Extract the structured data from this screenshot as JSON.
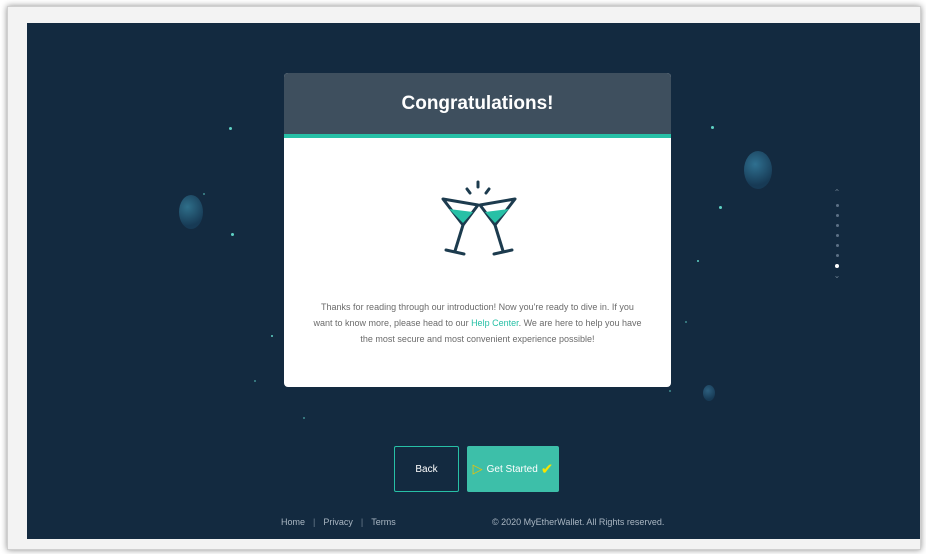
{
  "modal": {
    "title": "Congratulations!",
    "text_before_link": "Thanks for reading through our introduction! Now you're ready to dive in. If you want to know more, please head to our ",
    "link_text": "Help Center",
    "text_after_link": ". We are here to help you have the most secure and most convenient experience possible!",
    "icon": "cheers-cocktail-icon"
  },
  "pager": {
    "up_icon": "chevron-up-icon",
    "down_icon": "chevron-down-icon",
    "total": 7,
    "active_index": 6
  },
  "buttons": {
    "back_label": "Back",
    "get_started_label": "Get Started"
  },
  "footer": {
    "links": [
      "Home",
      "Privacy",
      "Terms"
    ],
    "copyright": "© 2020 MyEtherWallet. All Rights reserved."
  },
  "colors": {
    "background": "#132a40",
    "accent": "#27c0a6",
    "header": "#3e4f5e"
  }
}
